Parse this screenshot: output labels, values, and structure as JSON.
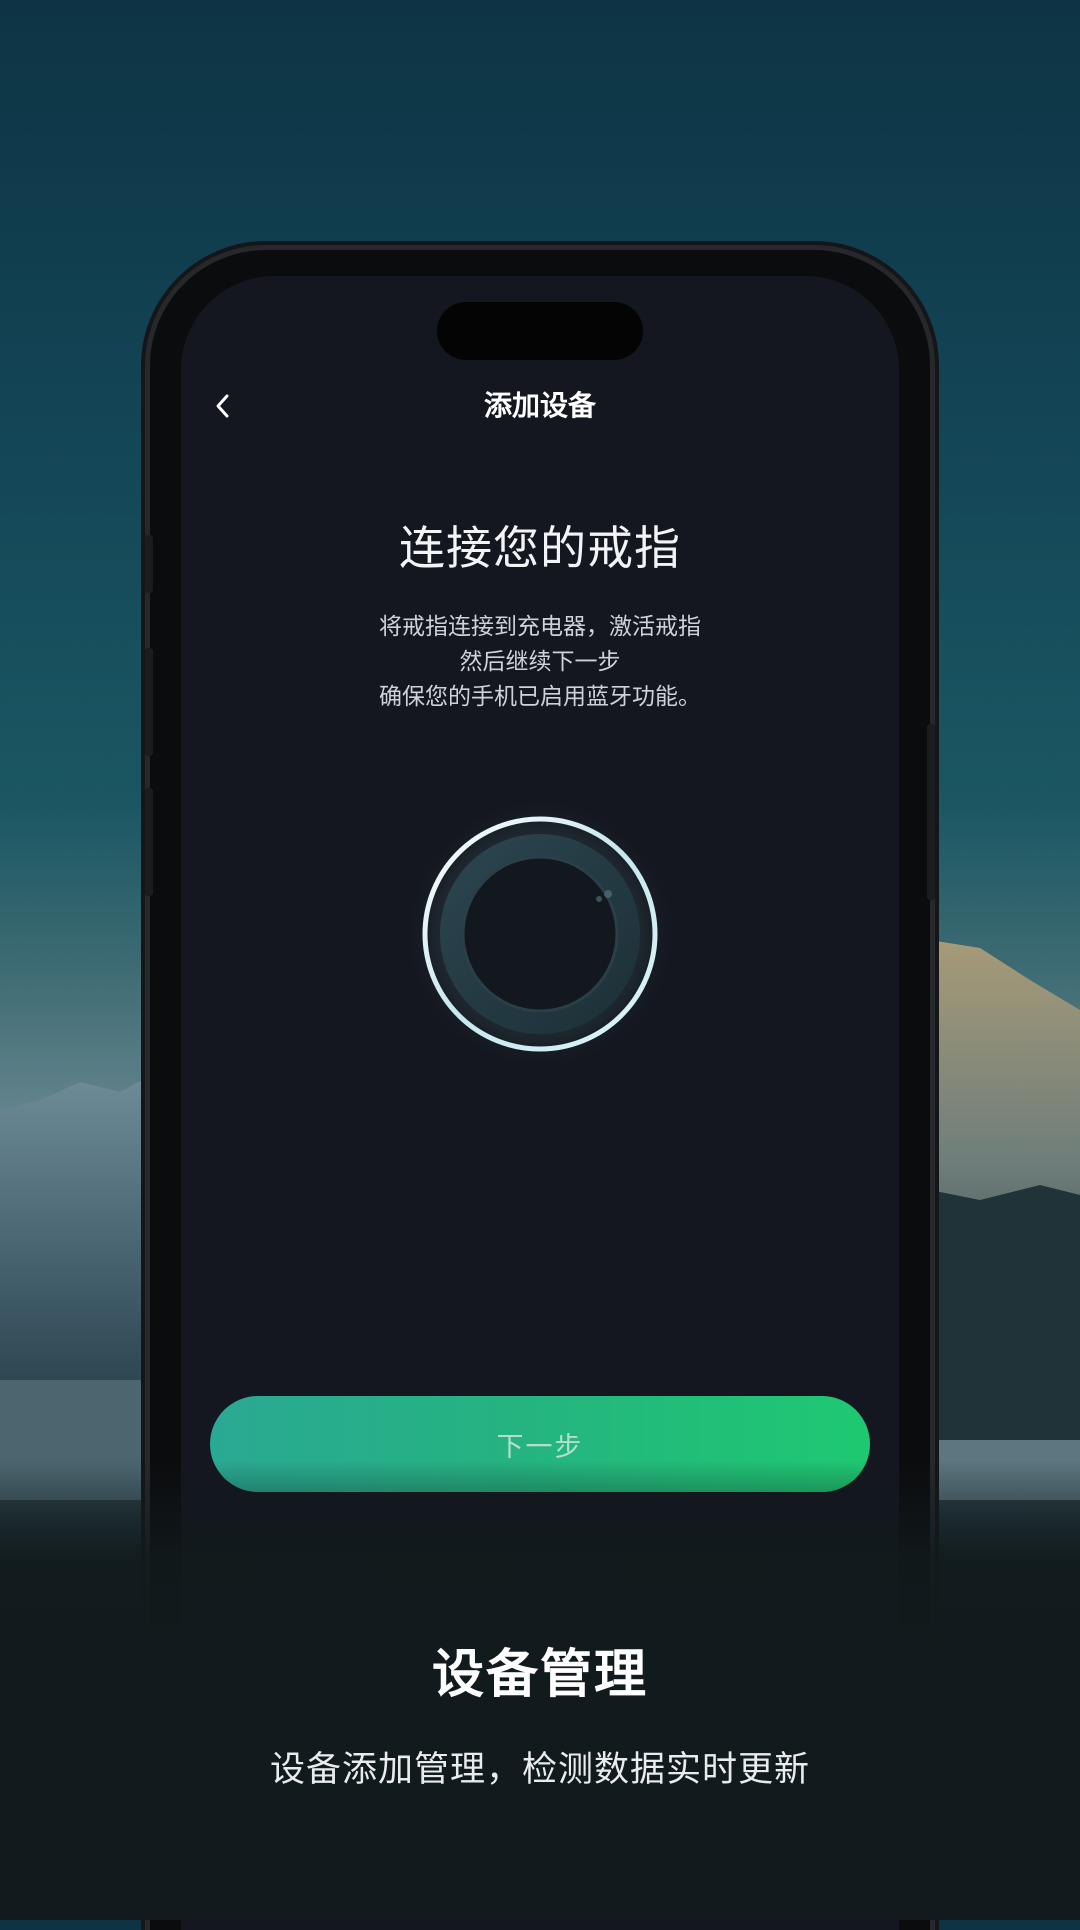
{
  "header": {
    "back_icon": "chevron-left-icon",
    "title": "添加设备"
  },
  "content": {
    "heading": "连接您的戒指",
    "description_lines": [
      "将戒指连接到充电器，激活戒指",
      "然后继续下一步",
      "确保您的手机已启用蓝牙功能。"
    ],
    "ring_image": "smart-ring-icon"
  },
  "actions": {
    "next_label": "下一步"
  },
  "promo": {
    "title": "设备管理",
    "subtitle": "设备添加管理，检测数据实时更新"
  },
  "colors": {
    "button_start": "#2aa993",
    "button_end": "#1ec971",
    "screen_background": "#14171f",
    "page_bottom": "#111a1c"
  }
}
